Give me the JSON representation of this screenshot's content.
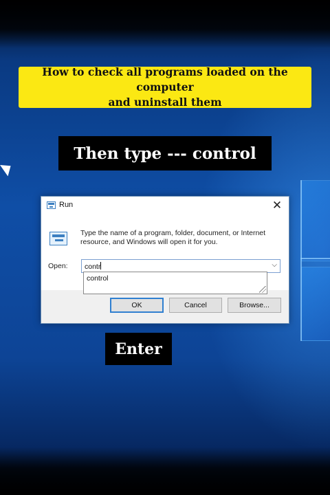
{
  "banner": {
    "line1": "How to check all programs loaded on the computer",
    "line2": "and uninstall them"
  },
  "captions": {
    "step1": "Then type --- control",
    "step2": "Enter"
  },
  "run_dialog": {
    "title": "Run",
    "close_glyph": "✕",
    "description": "Type the name of a program, folder, document, or Internet resource, and Windows will open it for you.",
    "open_label": "Open:",
    "input_value": "contr",
    "suggestion": "control",
    "buttons": {
      "ok": "OK",
      "cancel": "Cancel",
      "browse": "Browse..."
    },
    "accent_color": "#2f7fd0"
  },
  "icons": [
    "run-app-icon",
    "run-program-icon",
    "close-icon",
    "chevron-down-icon",
    "resize-grip-icon",
    "mouse-pointer-icon",
    "windows-logo"
  ],
  "colors": {
    "banner_bg": "#fbe813",
    "caption_bg": "#000000",
    "desktop_blue": "#0f4ea6"
  }
}
